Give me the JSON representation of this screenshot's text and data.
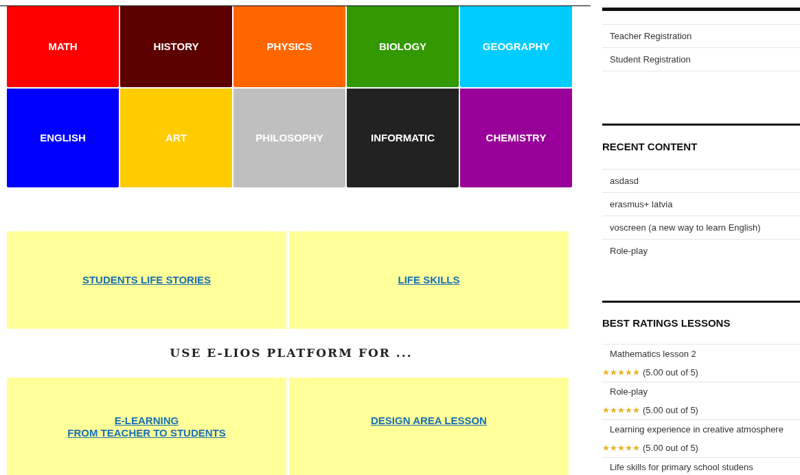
{
  "subjects": [
    {
      "label": "MATH",
      "color": "#ff0000"
    },
    {
      "label": "HISTORY",
      "color": "#5c0000"
    },
    {
      "label": "PHYSICS",
      "color": "#ff6600"
    },
    {
      "label": "BIOLOGY",
      "color": "#339900"
    },
    {
      "label": "GEOGRAPHY",
      "color": "#00ccff"
    },
    {
      "label": "ENGLISH",
      "color": "#0000ff"
    },
    {
      "label": "ART",
      "color": "#ffcc00"
    },
    {
      "label": "PHILOSOPHY",
      "color": "#bfbfbf"
    },
    {
      "label": "INFORMATIC",
      "color": "#222222"
    },
    {
      "label": "CHEMISTRY",
      "color": "#990099"
    }
  ],
  "top_links": [
    "STUDENTS LIFE STORIES",
    "LIFE SKILLS"
  ],
  "heading": "USE E-LIOS PLATFORM FOR ...",
  "bottom_links": [
    [
      "E-LEARNING",
      "FROM TEACHER TO STUDENTS"
    ],
    [
      "DESIGN AREA LESSON"
    ]
  ],
  "sidebar": {
    "registration": [
      "Teacher Registration",
      "Student Registration"
    ],
    "recent": {
      "title": "RECENT CONTENT",
      "items": [
        "asdasd",
        "erasmus+ latvia",
        "voscreen (a new way to learn English)",
        "Role-play"
      ]
    },
    "ratings": {
      "title": "BEST RATINGS LESSONS",
      "items": [
        {
          "title": "Mathematics lesson 2",
          "stars": 5,
          "rating": "(5.00 out of 5)"
        },
        {
          "title": "Role-play",
          "stars": 5,
          "rating": "(5.00 out of 5)"
        },
        {
          "title": "Learning experience in creative atmosphere",
          "stars": 5,
          "rating": "(5.00 out of 5)"
        },
        {
          "title": "Life skills for primary school studens"
        }
      ]
    }
  }
}
